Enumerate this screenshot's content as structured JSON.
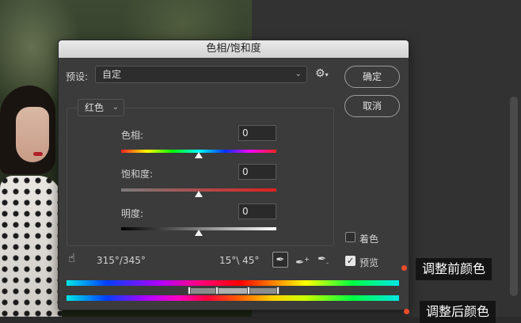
{
  "dialog": {
    "title": "色相/饱和度",
    "preset_label": "预设:",
    "preset_value": "自定",
    "ok_label": "确定",
    "cancel_label": "取消",
    "channel_value": "红色"
  },
  "sliders": {
    "hue": {
      "label": "色相:",
      "value": "0",
      "position": 0.5
    },
    "saturation": {
      "label": "饱和度:",
      "value": "0",
      "position": 0.5
    },
    "lightness": {
      "label": "明度:",
      "value": "0",
      "position": 0.5
    }
  },
  "options": {
    "colorize_label": "着色",
    "colorize_checked": false,
    "preview_label": "预览",
    "preview_checked": true
  },
  "range": {
    "left": "315°/345°",
    "right": "15°\\ 45°"
  },
  "icons": {
    "hand": "pointing-hand-icon",
    "gear": "gear-icon",
    "eyedropper": "eyedropper-icon",
    "eyedropper_add": "eyedropper-plus-icon",
    "eyedropper_sub": "eyedropper-minus-icon"
  },
  "annotations": {
    "before": "调整前颜色",
    "after": "调整后颜色"
  },
  "colors": {
    "accent_dot": "#e84c2b",
    "tag_bg": "#141414"
  }
}
